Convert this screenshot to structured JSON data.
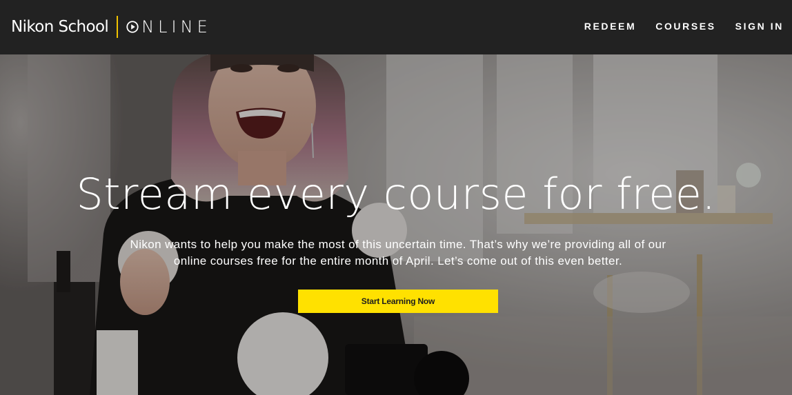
{
  "header": {
    "logo": {
      "brand": "Nikon School",
      "product": "NLINE",
      "divider_color": "#f2c400",
      "play_icon": "play-circle-icon"
    },
    "nav": [
      {
        "label": "REDEEM"
      },
      {
        "label": "COURSES"
      },
      {
        "label": "SIGN IN"
      }
    ]
  },
  "hero": {
    "title": "Stream every course for free.",
    "subtitle": "Nikon wants to help you make the most of this uncertain time. That’s why we’re providing all of our online courses free for the entire month of April. Let’s come out of this even better.",
    "cta_label": "Start Learning Now",
    "cta_color": "#ffe100",
    "background": "photo-smiling-woman-with-camera"
  }
}
